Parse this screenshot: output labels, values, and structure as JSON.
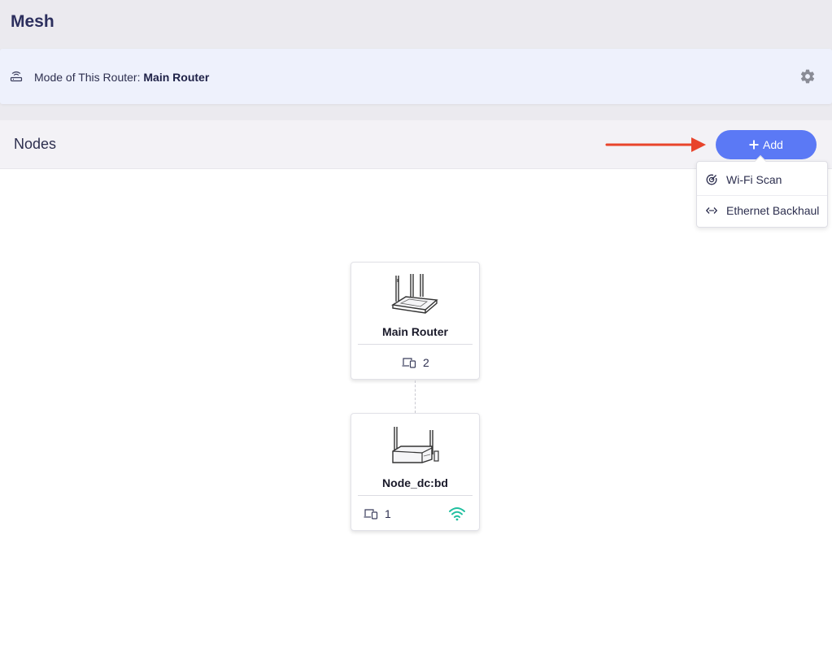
{
  "header": {
    "title": "Mesh"
  },
  "mode": {
    "label": "Mode of This Router: ",
    "value": "Main Router",
    "icon": "router-icon",
    "settings_icon": "gear-icon"
  },
  "nodes": {
    "title": "Nodes",
    "add_label": "Add",
    "menu": [
      {
        "label": "Wi-Fi Scan",
        "icon": "wifi-scan-icon"
      },
      {
        "label": "Ethernet Backhaul",
        "icon": "ethernet-icon"
      }
    ]
  },
  "cards": [
    {
      "name": "Main Router",
      "clients": "2",
      "icon": "client-devices-icon"
    },
    {
      "name": "Node_dc:bd",
      "clients": "1",
      "icon": "client-devices-icon",
      "link_icon": "wifi-icon",
      "link_color": "#1fbf9f"
    }
  ],
  "colors": {
    "accent": "#5b79f5",
    "arrow": "#e8442b",
    "title": "#2c2f5e"
  }
}
